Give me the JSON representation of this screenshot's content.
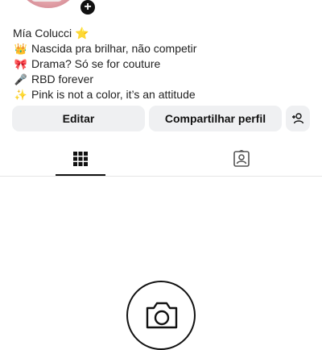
{
  "profile": {
    "avatar_add_symbol": "+",
    "bio": [
      {
        "emoji": "",
        "text": "Mía Colucci ⭐"
      },
      {
        "emoji": "👑",
        "text": "Nascida pra brilhar, não competir"
      },
      {
        "emoji": "🎀",
        "text": "Drama? Só se for couture"
      },
      {
        "emoji": "🎤",
        "text": "RBD forever"
      },
      {
        "emoji": "✨",
        "text": "Pink is not a color, it’s an attitude"
      }
    ]
  },
  "actions": {
    "edit_label": "Editar",
    "share_label": "Compartilhar perfil"
  },
  "tabs": {
    "posts_icon": "grid-icon",
    "tagged_icon": "tagged-person-icon"
  },
  "empty_state": {
    "icon": "camera-icon"
  },
  "colors": {
    "button_bg": "#eff0f2",
    "text": "#111111",
    "divider": "#e6e6e6"
  }
}
